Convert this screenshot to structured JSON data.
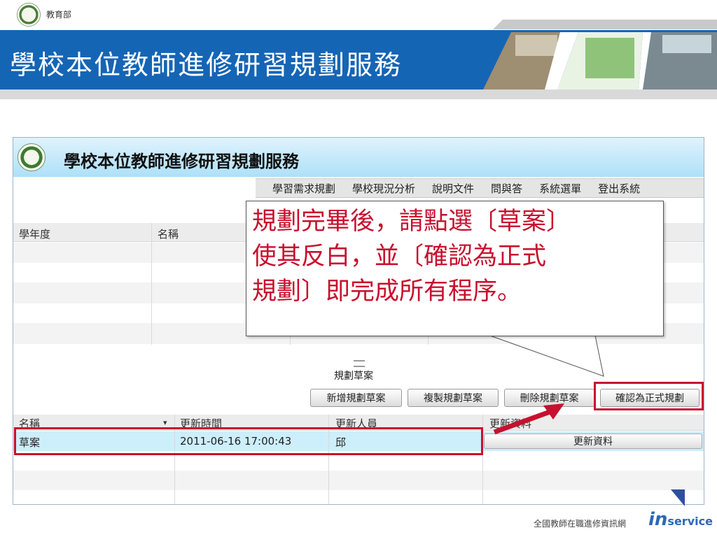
{
  "slide": {
    "ministry": "教育部",
    "title": "學校本位教師進修研習規劃服務",
    "footer": "全國教師在職進修資訊網",
    "logo": {
      "prefix": "in",
      "suffix": "service"
    }
  },
  "app": {
    "title": "學校本位教師進修研習規劃服務",
    "menu": [
      "學習需求規劃",
      "學校現況分析",
      "說明文件",
      "問與答",
      "系統選單",
      "登出系統"
    ],
    "plan_columns": [
      "學年度",
      "名稱"
    ],
    "plan_rows": 5,
    "draft_section_title": "規劃草案",
    "buttons": {
      "add": "新增規劃草案",
      "copy": "複製規劃草案",
      "delete": "刪除規劃草案",
      "confirm": "確認為正式規劃"
    },
    "draft_columns": {
      "name": "名稱",
      "name_sort_icon": "▾",
      "updated_time": "更新時間",
      "updated_by": "更新人員",
      "update_data": "更新資料"
    },
    "draft_rows": [
      {
        "name": "草案",
        "updated_time": "2011-06-16 17:00:43",
        "updated_by": "邱",
        "action": "更新資料",
        "selected": true
      }
    ]
  },
  "callout": {
    "lines": [
      "規劃完畢後，請點選〔草案〕",
      "使其反白，並〔確認為正式",
      "規劃〕即完成所有程序。"
    ]
  },
  "colors": {
    "title_band": "#1565b5",
    "highlight": "#c8102e",
    "app_header": "#aee0f8",
    "selected_row": "#cdeefb"
  }
}
